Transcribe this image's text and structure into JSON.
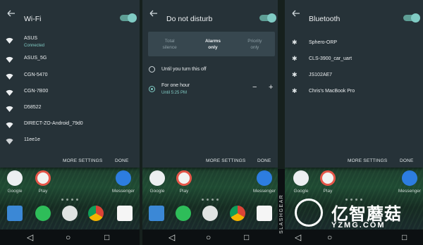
{
  "wifi": {
    "title": "Wi-Fi",
    "networks": [
      {
        "name": "ASUS",
        "status": "Connected"
      },
      {
        "name": "ASUS_5G"
      },
      {
        "name": "CGN-5470"
      },
      {
        "name": "CGN-7B00"
      },
      {
        "name": "D58522"
      },
      {
        "name": "DIRECT-ZO-Android_79d0"
      },
      {
        "name": "11ee1e"
      }
    ],
    "more_settings": "MORE SETTINGS",
    "done": "DONE"
  },
  "dnd": {
    "title": "Do not disturb",
    "segments": [
      {
        "label": "Total silence"
      },
      {
        "label": "Alarms only"
      },
      {
        "label": "Priority only"
      }
    ],
    "options": [
      {
        "label": "Until you turn this off"
      },
      {
        "label": "For one hour",
        "sub": "Until 5:25 PM"
      }
    ],
    "minus": "−",
    "plus": "+",
    "more_settings": "MORE SETTINGS",
    "done": "DONE"
  },
  "bluetooth": {
    "title": "Bluetooth",
    "devices": [
      {
        "name": "Sphero-ORP"
      },
      {
        "name": "CLS-3900_car_uart"
      },
      {
        "name": "JS102AE7"
      },
      {
        "name": "Chris's MacBook Pro"
      }
    ],
    "more_settings": "MORE SETTINGS",
    "done": "DONE"
  },
  "home": {
    "apps": [
      {
        "label": "Google"
      },
      {
        "label": "Play"
      },
      {
        "label": "Messenger"
      }
    ]
  },
  "watermark": {
    "side_text": "SLASHGEAR",
    "brand_cn": "亿智蘑菇",
    "brand_en": "YZMG.COM"
  },
  "colors": {
    "panel": "#263238",
    "accent": "#80cbc4"
  }
}
